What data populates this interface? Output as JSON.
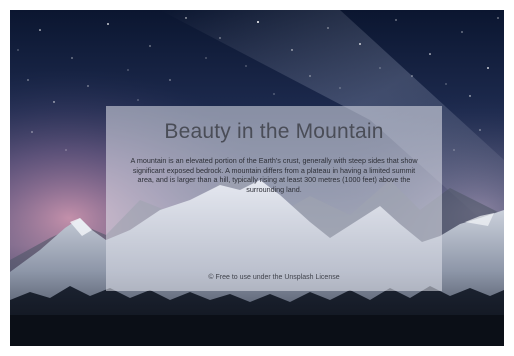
{
  "hero": {
    "title": "Beauty in the Mountain",
    "description": "A mountain is an elevated portion of the Earth's crust, generally with steep sides that show significant exposed bedrock. A mountain differs from a plateau in having a limited summit area, and is larger than a hill, typically rising at least 300 metres (1000 feet) above the surrounding land.",
    "credit": "© Free to use under the Unsplash License"
  },
  "colors": {
    "sky_top": "#0b1630",
    "sky_glow": "#c77a9a",
    "card_overlay": "#e1e4ec"
  }
}
